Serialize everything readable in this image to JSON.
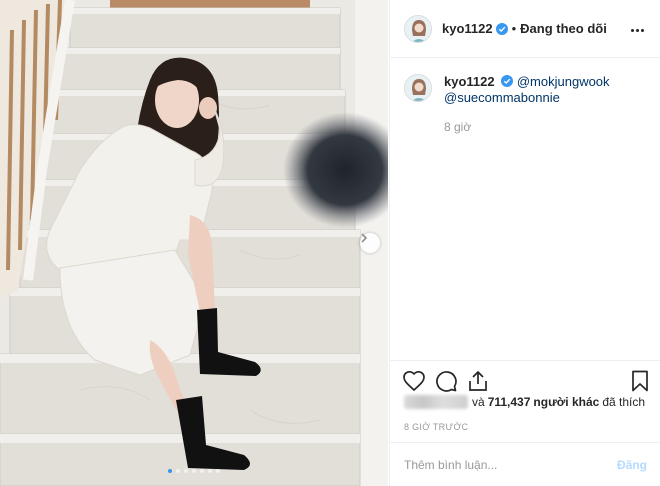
{
  "header": {
    "username": "kyo1122",
    "separator": "•",
    "follow_status": "Đang theo dõi"
  },
  "caption": {
    "username": "kyo1122",
    "mentions": [
      "@mokjungwook",
      "@suecommabonnie"
    ],
    "time": "8 giờ"
  },
  "likes": {
    "count": "711,437",
    "prefix": "và",
    "suffix_bold": "người khác",
    "suffix": "đã thích"
  },
  "post_time": "8 GIỜ TRƯỚC",
  "comment": {
    "placeholder": "Thêm bình luận...",
    "post_label": "Đăng"
  },
  "carousel": {
    "slide_count": 7,
    "active_index": 0
  },
  "colors": {
    "verified": "#3897f0",
    "mention": "#003569",
    "post_disabled": "#b3dbff"
  },
  "icons": [
    "verified-icon",
    "more-options-icon",
    "heart-icon",
    "comment-icon",
    "share-icon",
    "bookmark-icon",
    "chevron-right-icon"
  ]
}
